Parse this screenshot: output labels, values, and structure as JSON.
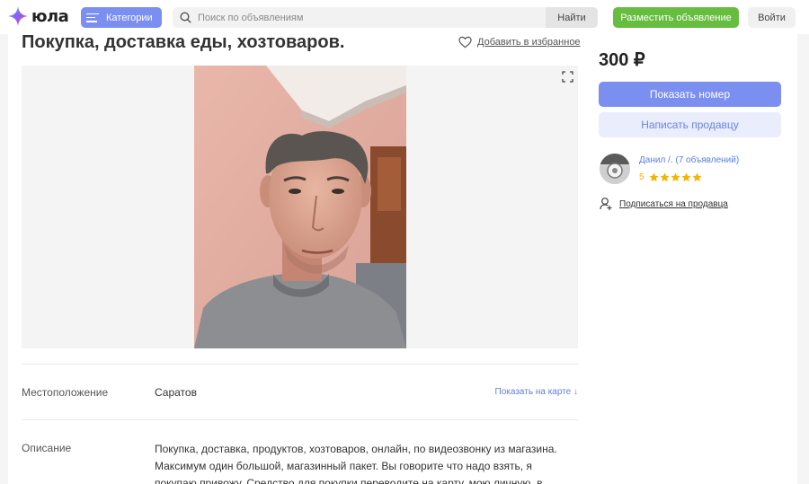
{
  "header": {
    "logo_text": "юла",
    "categories_label": "Категории",
    "search_placeholder": "Поиск по объявлениям",
    "search_button": "Найти",
    "post_button": "Разместить объявление",
    "login_button": "Войти"
  },
  "listing": {
    "title": "Покупка, доставка еды, хозтоваров.",
    "favorite_label": "Добавить в избранное",
    "price": "300 ₽",
    "location_label": "Местоположение",
    "location_value": "Саратов",
    "show_map_label": "Показать на карте ↓",
    "description_label": "Описание",
    "description_text": "Покупка, доставка, продуктов, хозтоваров, онлайн, по видеозвонку из магазина. Максимум один большой, магазинный пакет. Вы говорите что надо взять, я покупаю привожу. Средство для покупки переводите на карту, мою личную, в"
  },
  "seller": {
    "show_phone_button": "Показать номер",
    "write_button": "Написать продавцу",
    "name": "Данил /. (7 объявлений)",
    "rating_value": "5",
    "rating_stars": 5,
    "subscribe_label": "Подписаться на продавца"
  },
  "icons": {
    "logo": "star-sparkle-logo-icon",
    "menu": "burger-menu-icon",
    "search": "search-icon",
    "favorite": "heart-outline-icon",
    "expand": "fullscreen-expand-icon",
    "star": "star-icon",
    "subscribe": "person-add-icon"
  },
  "colors": {
    "accent_blue": "#7b8ff0",
    "light_blue": "#e9edfc",
    "link_blue": "#5b7fe0",
    "green": "#66bd3f",
    "star_yellow": "#f5b400"
  }
}
